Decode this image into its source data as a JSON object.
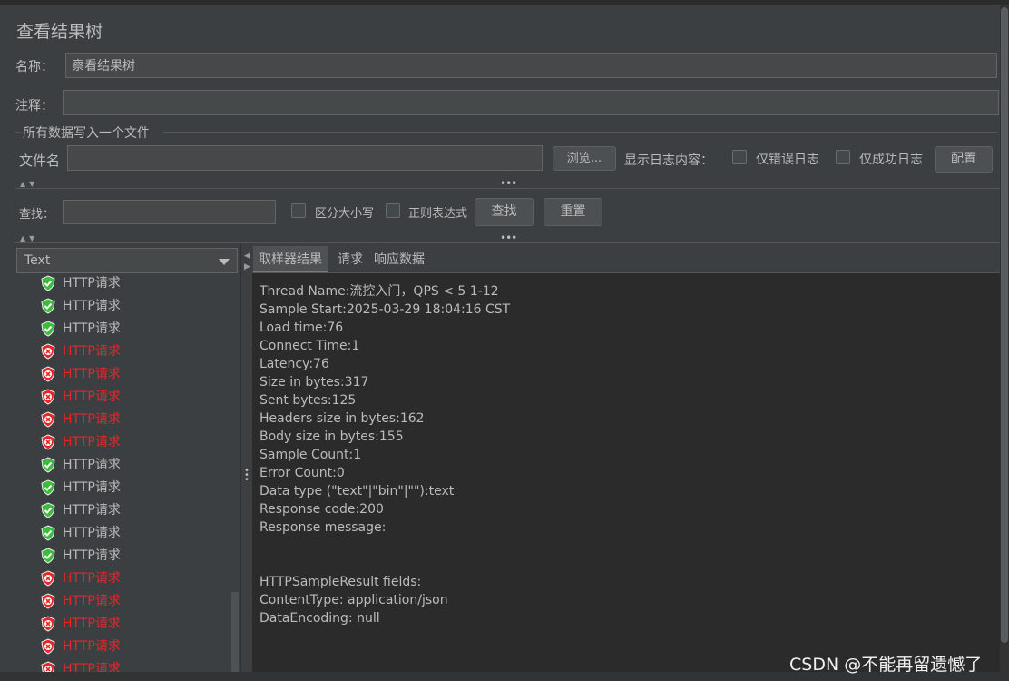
{
  "panel": {
    "title": "查看结果树"
  },
  "form": {
    "name_label": "名称：",
    "name_value": "察看结果树",
    "comment_label": "注释：",
    "comment_value": ""
  },
  "file_section": {
    "group_title": "所有数据写入一个文件",
    "filename_label": "文件名",
    "filename_value": "",
    "browse_label": "浏览...",
    "log_content_label": "显示日志内容：",
    "errors_only_label": "仅错误日志",
    "success_only_label": "仅成功日志",
    "configure_label": "配置"
  },
  "search": {
    "label": "查找：",
    "value": "",
    "case_sensitive_label": "区分大小写",
    "regex_label": "正则表达式",
    "find_label": "查找",
    "reset_label": "重置"
  },
  "renderer": {
    "selected": "Text"
  },
  "tree": {
    "items": [
      {
        "label": "HTTP请求",
        "status": "ok"
      },
      {
        "label": "HTTP请求",
        "status": "ok"
      },
      {
        "label": "HTTP请求",
        "status": "ok"
      },
      {
        "label": "HTTP请求",
        "status": "err"
      },
      {
        "label": "HTTP请求",
        "status": "err"
      },
      {
        "label": "HTTP请求",
        "status": "err"
      },
      {
        "label": "HTTP请求",
        "status": "err"
      },
      {
        "label": "HTTP请求",
        "status": "err"
      },
      {
        "label": "HTTP请求",
        "status": "ok"
      },
      {
        "label": "HTTP请求",
        "status": "ok"
      },
      {
        "label": "HTTP请求",
        "status": "ok"
      },
      {
        "label": "HTTP请求",
        "status": "ok"
      },
      {
        "label": "HTTP请求",
        "status": "ok"
      },
      {
        "label": "HTTP请求",
        "status": "err"
      },
      {
        "label": "HTTP请求",
        "status": "err"
      },
      {
        "label": "HTTP请求",
        "status": "err"
      },
      {
        "label": "HTTP请求",
        "status": "err"
      },
      {
        "label": "HTTP请求",
        "status": "err"
      }
    ]
  },
  "tabs": [
    "取样器结果",
    "请求",
    "响应数据"
  ],
  "active_tab": "取样器结果",
  "result_lines": [
    "Thread Name:流控入门，QPS < 5 1-12",
    "Sample Start:2025-03-29 18:04:16 CST",
    "Load time:76",
    "Connect Time:1",
    "Latency:76",
    "Size in bytes:317",
    "Sent bytes:125",
    "Headers size in bytes:162",
    "Body size in bytes:155",
    "Sample Count:1",
    "Error Count:0",
    "Data type (\"text\"|\"bin\"|\"\"):text",
    "Response code:200",
    "Response message:",
    "",
    "",
    "HTTPSampleResult fields:",
    "ContentType: application/json",
    "DataEncoding: null"
  ],
  "watermark": "CSDN @不能再留遗憾了",
  "colors": {
    "ok": "#3dbb3d",
    "err": "#e8262a",
    "accent": "#4a88c7"
  }
}
